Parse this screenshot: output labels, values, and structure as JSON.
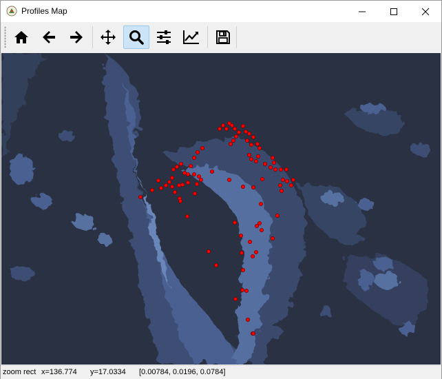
{
  "window": {
    "title": "Profiles Map"
  },
  "title_buttons": [
    "minimize",
    "maximize",
    "close"
  ],
  "toolbar": {
    "buttons": [
      {
        "name": "home",
        "icon": "home-icon"
      },
      {
        "name": "back",
        "icon": "arrow-left-icon"
      },
      {
        "name": "forward",
        "icon": "arrow-right-icon"
      },
      {
        "name": "pan",
        "icon": "move-icon"
      },
      {
        "name": "zoom",
        "icon": "magnifier-icon",
        "active": true
      },
      {
        "name": "subplots",
        "icon": "sliders-icon"
      },
      {
        "name": "edit-axis",
        "icon": "line-chart-icon"
      },
      {
        "name": "save",
        "icon": "floppy-icon"
      }
    ]
  },
  "map": {
    "marker_color": "#ff0000",
    "background_colors": [
      "#2a3142",
      "#39496a",
      "#5a76a6"
    ],
    "profiles": [
      [
        332,
        178
      ],
      [
        336,
        181
      ],
      [
        328,
        186
      ],
      [
        340,
        186
      ],
      [
        352,
        182
      ],
      [
        346,
        191
      ],
      [
        356,
        190
      ],
      [
        342,
        197
      ],
      [
        338,
        203
      ],
      [
        334,
        208
      ],
      [
        361,
        193
      ],
      [
        367,
        198
      ],
      [
        358,
        203
      ],
      [
        364,
        209
      ],
      [
        373,
        208
      ],
      [
        376,
        214
      ],
      [
        361,
        224
      ],
      [
        364,
        230
      ],
      [
        371,
        233
      ],
      [
        374,
        226
      ],
      [
        384,
        237
      ],
      [
        395,
        228
      ],
      [
        397,
        235
      ],
      [
        392,
        242
      ],
      [
        399,
        245
      ],
      [
        407,
        245
      ],
      [
        415,
        245
      ],
      [
        410,
        260
      ],
      [
        406,
        268
      ],
      [
        408,
        276
      ],
      [
        416,
        262
      ],
      [
        425,
        260
      ],
      [
        422,
        268
      ],
      [
        380,
        259
      ],
      [
        367,
        271
      ],
      [
        352,
        270
      ],
      [
        332,
        260
      ],
      [
        318,
        186
      ],
      [
        323,
        181
      ],
      [
        307,
        248
      ],
      [
        293,
        214
      ],
      [
        286,
        220
      ],
      [
        281,
        228
      ],
      [
        276,
        240
      ],
      [
        272,
        252
      ],
      [
        262,
        237
      ],
      [
        256,
        241
      ],
      [
        251,
        245
      ],
      [
        249,
        257
      ],
      [
        245,
        263
      ],
      [
        240,
        268
      ],
      [
        233,
        272
      ],
      [
        229,
        261
      ],
      [
        220,
        275
      ],
      [
        203,
        285
      ],
      [
        249,
        270
      ],
      [
        253,
        278
      ],
      [
        260,
        287
      ],
      [
        261,
        291
      ],
      [
        259,
        268
      ],
      [
        264,
        267
      ],
      [
        272,
        264
      ],
      [
        281,
        252
      ],
      [
        288,
        255
      ],
      [
        291,
        260
      ],
      [
        285,
        266
      ],
      [
        282,
        280
      ],
      [
        267,
        250
      ],
      [
        271,
        313
      ],
      [
        302,
        364
      ],
      [
        313,
        384
      ],
      [
        378,
        295
      ],
      [
        376,
        323
      ],
      [
        372,
        327
      ],
      [
        379,
        333
      ],
      [
        349,
        341
      ],
      [
        350,
        366
      ],
      [
        362,
        350
      ],
      [
        371,
        365
      ],
      [
        366,
        371
      ],
      [
        395,
        345
      ],
      [
        402,
        312
      ],
      [
        352,
        391
      ],
      [
        351,
        420
      ],
      [
        357,
        421
      ],
      [
        341,
        433
      ],
      [
        359,
        463
      ],
      [
        366,
        483
      ],
      [
        367,
        483
      ],
      [
        340,
        322
      ]
    ]
  },
  "status": {
    "mode": "zoom rect",
    "x_text": "x=136.774",
    "y_text": "y=17.0334",
    "values_text": "[0.00784, 0.0196, 0.0784]"
  }
}
